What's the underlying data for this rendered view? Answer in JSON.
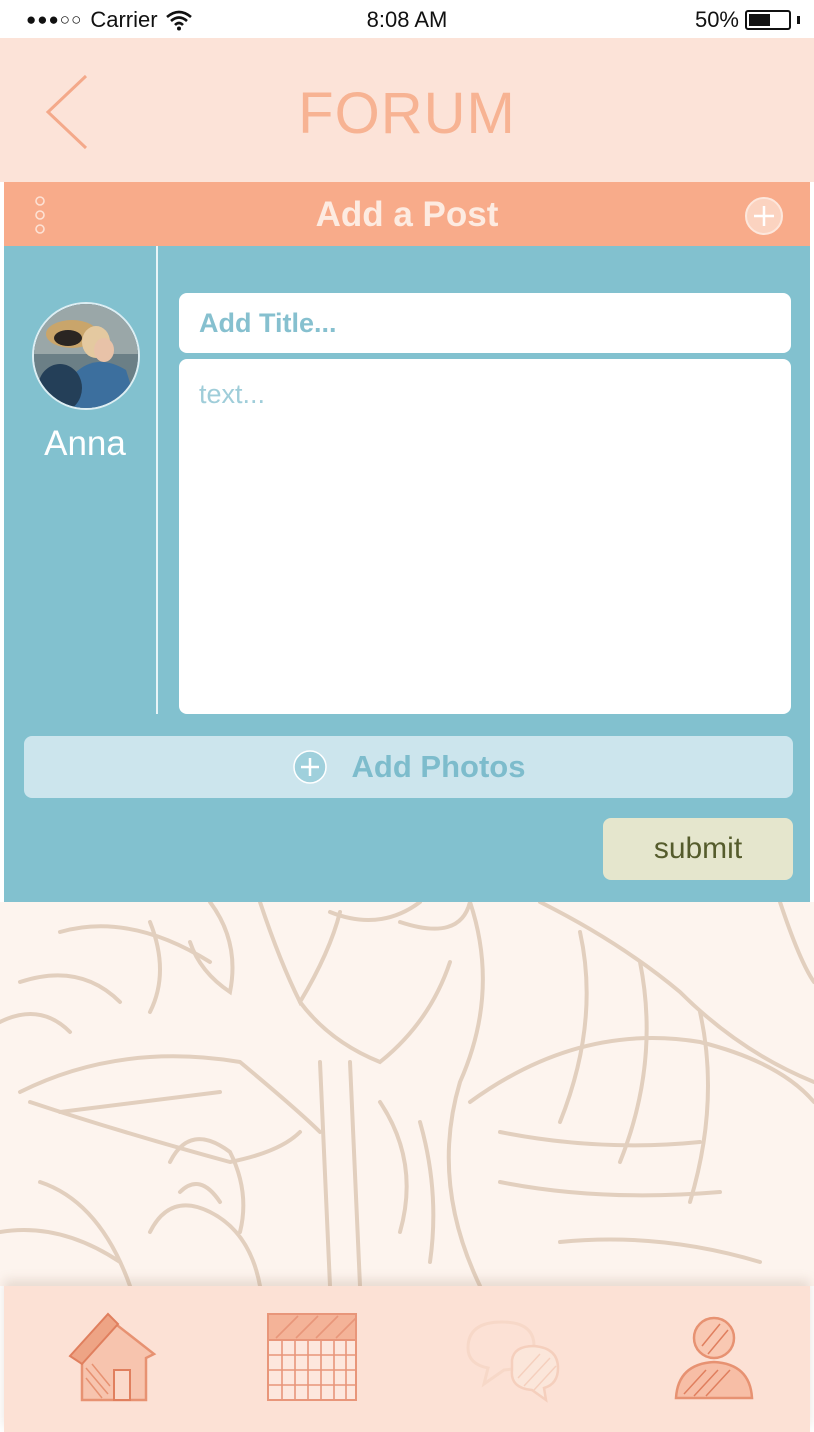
{
  "status_bar": {
    "signal_dots": "●●●○○",
    "carrier": "Carrier",
    "time": "8:08 AM",
    "battery": "50%"
  },
  "nav": {
    "title": "FORUM",
    "back_icon": "chevron-left-icon"
  },
  "post_header": {
    "title": "Add a Post",
    "menu_icon": "vertical-dots-icon",
    "add_icon": "plus-circle-icon"
  },
  "composer": {
    "user_name": "Anna",
    "title_placeholder": "Add Title...",
    "text_placeholder": "text...",
    "add_photos_label": "Add Photos",
    "submit_label": "submit"
  },
  "tabs": [
    {
      "icon": "home-icon"
    },
    {
      "icon": "calendar-icon"
    },
    {
      "icon": "chat-bubbles-icon"
    },
    {
      "icon": "profile-icon"
    }
  ],
  "colors": {
    "nav_background": "#fce3d8",
    "accent_orange": "#f8ab8a",
    "compose_teal": "#82c1cf",
    "submit_background": "#e5e6cd"
  }
}
